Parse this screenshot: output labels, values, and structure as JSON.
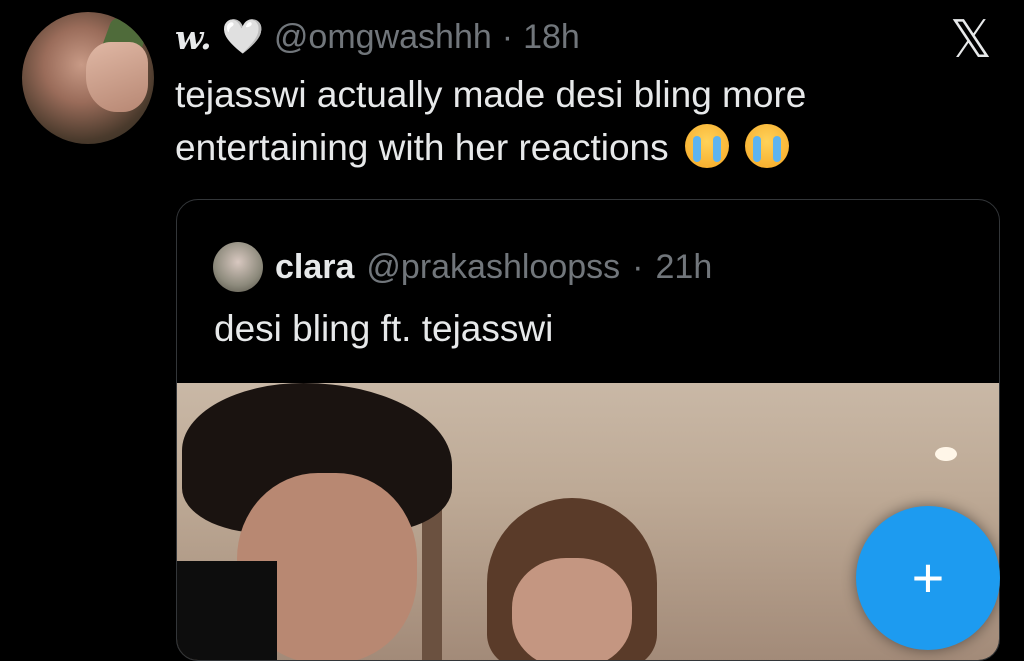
{
  "tweet": {
    "display_name": "w.",
    "heart": "🤍",
    "handle": "@omgwashhh",
    "separator": "·",
    "time": "18h",
    "text": "tejasswi actually made desi bling more entertaining with her reactions",
    "emojis": [
      "😭",
      "😭"
    ],
    "x_logo": "𝕏"
  },
  "quote": {
    "name": "clara",
    "handle": "@prakashloopss",
    "separator": "·",
    "time": "21h",
    "text": "desi bling ft. tejasswi"
  },
  "fab": {
    "label": "+",
    "icon": "plus-icon",
    "color": "#1d9bf0"
  }
}
